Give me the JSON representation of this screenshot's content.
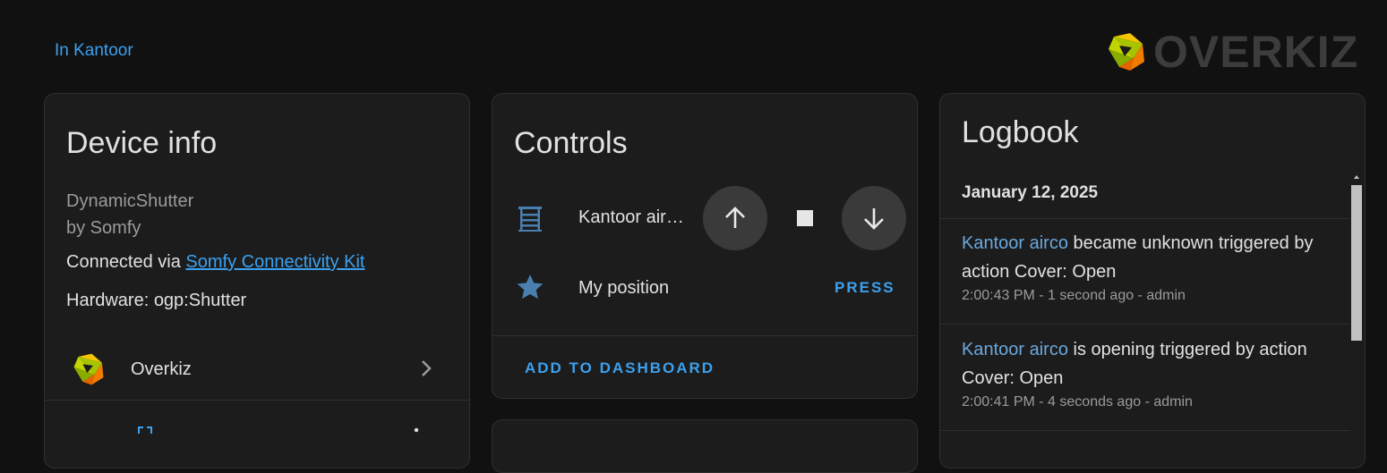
{
  "header": {
    "area_link": "In Kantoor",
    "brand_name": "OVERKIZ"
  },
  "device_info": {
    "title": "Device info",
    "model": "DynamicShutter",
    "manufacturer": "by Somfy",
    "connected_prefix": "Connected via ",
    "connected_link": "Somfy Connectivity Kit",
    "hardware": "Hardware: ogp:Shutter",
    "integration": {
      "label": "Overkiz",
      "icon": "overkiz-logo-icon"
    }
  },
  "controls": {
    "title": "Controls",
    "cover": {
      "name": "Kantoor air…",
      "icon": "window-shutter-icon"
    },
    "my_position": {
      "name": "My position",
      "icon": "star-icon",
      "action": "PRESS"
    },
    "add_to_dashboard": "ADD TO DASHBOARD"
  },
  "logbook": {
    "title": "Logbook",
    "date": "January 12, 2025",
    "entries": [
      {
        "entity": "Kantoor airco",
        "message": " became unknown triggered by action Cover: Open",
        "meta": "2:00:43 PM - 1 second ago - admin"
      },
      {
        "entity": "Kantoor airco",
        "message": " is opening triggered by action Cover: Open",
        "meta": "2:00:41 PM - 4 seconds ago - admin"
      }
    ]
  },
  "colors": {
    "accent": "#3ba1f0",
    "background": "#111111",
    "card": "#1c1c1c",
    "icon_blue": "#4a7fb0"
  }
}
